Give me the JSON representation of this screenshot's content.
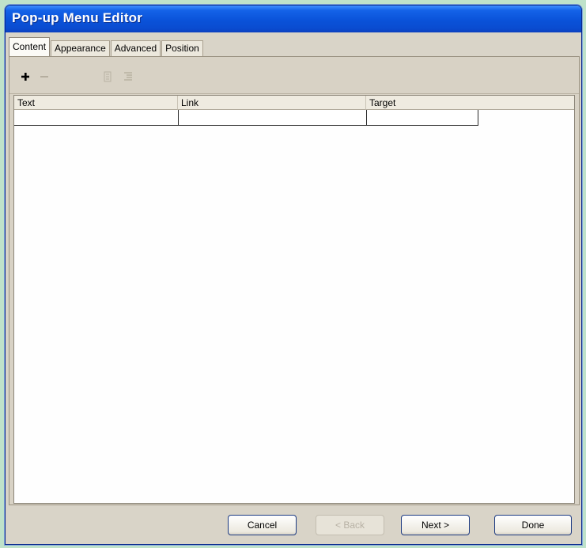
{
  "window": {
    "title": "Pop-up Menu Editor"
  },
  "tabs": [
    {
      "label": "Content"
    },
    {
      "label": "Appearance"
    },
    {
      "label": "Advanced"
    },
    {
      "label": "Position"
    }
  ],
  "toolbar": {
    "add_icon": "plus-icon",
    "remove_icon": "minus-icon",
    "indent_icon": "indent-icon",
    "outdent_icon": "outdent-icon"
  },
  "grid": {
    "columns": [
      {
        "label": "Text"
      },
      {
        "label": "Link"
      },
      {
        "label": "Target"
      }
    ]
  },
  "buttons": {
    "cancel": "Cancel",
    "back": "< Back",
    "next": "Next >",
    "done": "Done"
  },
  "colors": {
    "title_bar": "#0a52d9",
    "dialog_face": "#d9d4c8",
    "backdrop": "#bfe2ca",
    "button_border": "#1c3a82"
  }
}
